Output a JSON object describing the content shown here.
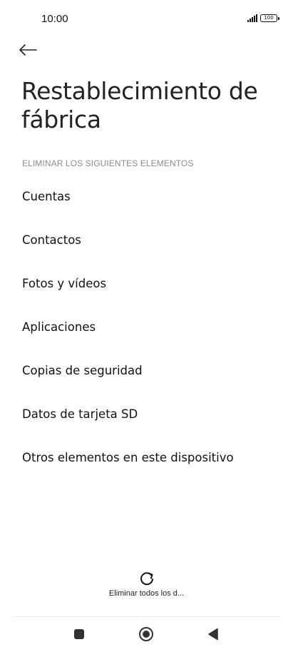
{
  "status_bar": {
    "time": "10:00",
    "battery": "100"
  },
  "header": {
    "back_icon": "arrow-left-icon",
    "title": "Restablecimiento de fábrica"
  },
  "section": {
    "header": "ELIMINAR LOS SIGUIENTES ELEMENTOS",
    "items": [
      {
        "label": "Cuentas"
      },
      {
        "label": "Contactos"
      },
      {
        "label": "Fotos y vídeos"
      },
      {
        "label": "Aplicaciones"
      },
      {
        "label": "Copias de seguridad"
      },
      {
        "label": "Datos de tarjeta SD"
      },
      {
        "label": "Otros elementos en este dispositivo"
      }
    ]
  },
  "action": {
    "icon": "refresh-icon",
    "label": "Eliminar todos los d..."
  },
  "nav": {
    "recents_icon": "square-icon",
    "home_icon": "circle-icon",
    "back_icon": "triangle-back-icon"
  }
}
